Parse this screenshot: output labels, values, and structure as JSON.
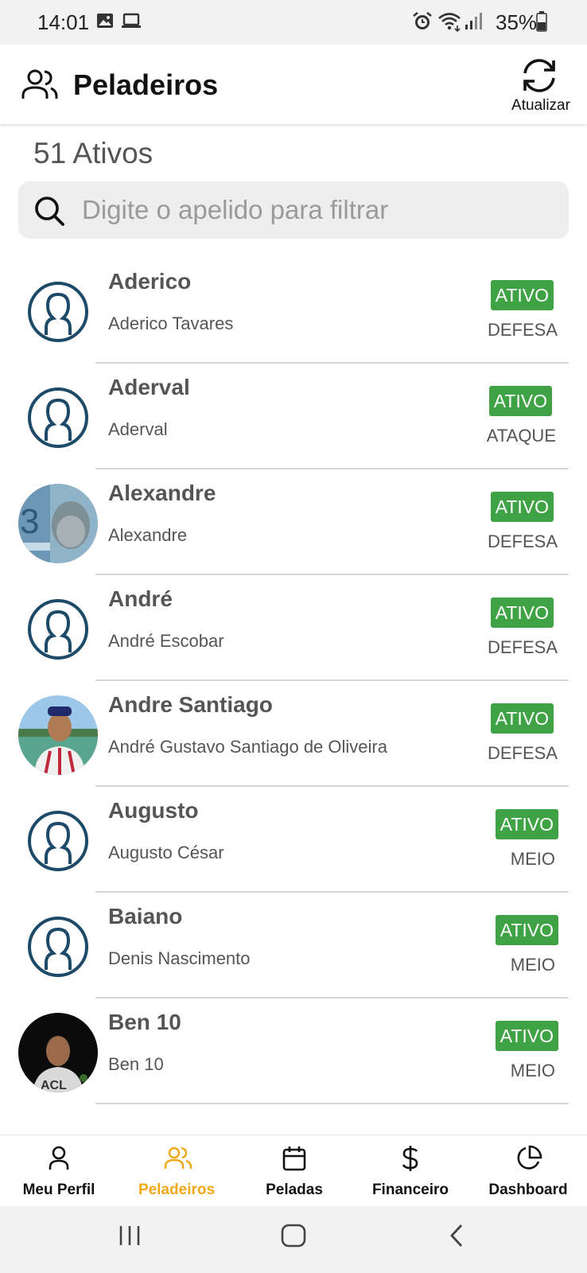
{
  "status_bar": {
    "time": "14:01",
    "battery": "35%",
    "icons": [
      "image-icon",
      "laptop-icon",
      "alarm-icon",
      "wifi-icon",
      "signal-icon",
      "battery-icon"
    ]
  },
  "header": {
    "title": "Peladeiros",
    "refresh_label": "Atualizar"
  },
  "active_count": "51 Ativos",
  "search": {
    "placeholder": "Digite o apelido para filtrar",
    "value": ""
  },
  "players": [
    {
      "nickname": "Aderico",
      "full_name": "Aderico Tavares",
      "status": "ATIVO",
      "position": "DEFESA",
      "avatar": "default"
    },
    {
      "nickname": "Aderval",
      "full_name": "Aderval",
      "status": "ATIVO",
      "position": "ATAQUE",
      "avatar": "default"
    },
    {
      "nickname": "Alexandre",
      "full_name": "Alexandre",
      "status": "ATIVO",
      "position": "DEFESA",
      "avatar": "photo"
    },
    {
      "nickname": "André",
      "full_name": "André Escobar",
      "status": "ATIVO",
      "position": "DEFESA",
      "avatar": "default"
    },
    {
      "nickname": "Andre Santiago",
      "full_name": "André Gustavo Santiago de Oliveira",
      "status": "ATIVO",
      "position": "DEFESA",
      "avatar": "photo"
    },
    {
      "nickname": "Augusto",
      "full_name": "Augusto César",
      "status": "ATIVO",
      "position": "MEIO",
      "avatar": "default"
    },
    {
      "nickname": "Baiano",
      "full_name": "Denis Nascimento",
      "status": "ATIVO",
      "position": "MEIO",
      "avatar": "default"
    },
    {
      "nickname": "Ben 10",
      "full_name": "Ben 10",
      "status": "ATIVO",
      "position": "MEIO",
      "avatar": "photo"
    }
  ],
  "bottom_nav": {
    "items": [
      {
        "label": "Meu Perfil",
        "icon": "user-icon"
      },
      {
        "label": "Peladeiros",
        "icon": "users-icon",
        "active": true
      },
      {
        "label": "Peladas",
        "icon": "calendar-icon"
      },
      {
        "label": "Financeiro",
        "icon": "dollar-icon"
      },
      {
        "label": "Dashboard",
        "icon": "pie-chart-icon"
      }
    ]
  },
  "colors": {
    "accent": "#f0a818",
    "status_active": "#3fa244",
    "avatar_outline": "#1e4a6a"
  }
}
